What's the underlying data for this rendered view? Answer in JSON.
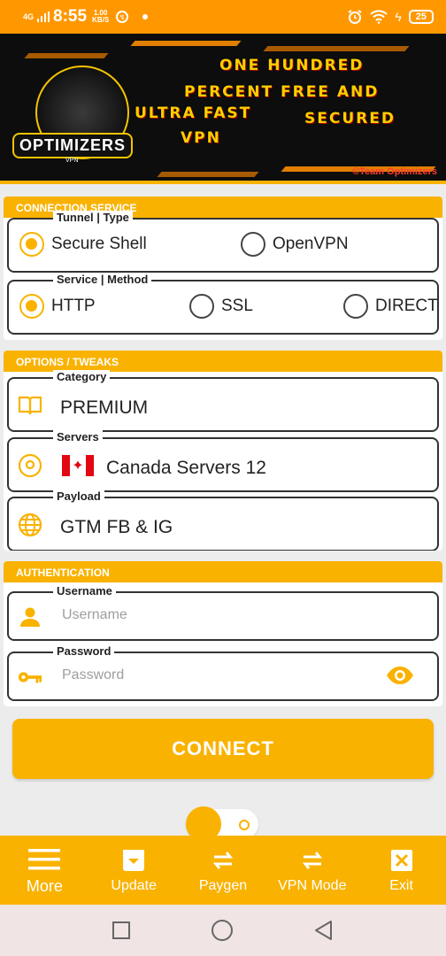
{
  "status": {
    "network": "4G",
    "time": "8:55",
    "speed_top": "1.00",
    "speed_bottom": "KB/S",
    "battery": "25"
  },
  "banner": {
    "line1": "ONE HUNDRED",
    "line2": "PERCENT FREE AND",
    "line3": "ULTRA FAST",
    "line3b": "SECURED",
    "line4": "VPN",
    "logo": "OPTIMIZERS",
    "logo_sub": "VPN",
    "credit": "©Team Optimizers"
  },
  "connection": {
    "header": "CONNECTION SERVICE",
    "tunnel_label": "Tunnel | Type",
    "tunnel_options": [
      "Secure Shell",
      "OpenVPN"
    ],
    "tunnel_selected": "Secure Shell",
    "method_label": "Service | Method",
    "method_options": [
      "HTTP",
      "SSL",
      "DIRECT"
    ],
    "method_selected": "HTTP"
  },
  "options": {
    "header": "OPTIONS / TWEAKS",
    "category_label": "Category",
    "category_value": "PREMIUM",
    "servers_label": "Servers",
    "servers_value": "Canada Servers 12",
    "payload_label": "Payload",
    "payload_value": "GTM FB & IG"
  },
  "auth": {
    "header": "AUTHENTICATION",
    "username_label": "Username",
    "username_placeholder": "Username",
    "password_label": "Password",
    "password_placeholder": "Password"
  },
  "connect_label": "CONNECT",
  "bottom_nav": [
    {
      "label": "More",
      "icon": "menu-icon"
    },
    {
      "label": "Update",
      "icon": "update-icon"
    },
    {
      "label": "Paygen",
      "icon": "swap-icon"
    },
    {
      "label": "VPN Mode",
      "icon": "swap-icon"
    },
    {
      "label": "Exit",
      "icon": "close-icon"
    }
  ],
  "colors": {
    "accent": "#f9b200",
    "status_bar": "#ff9800"
  }
}
